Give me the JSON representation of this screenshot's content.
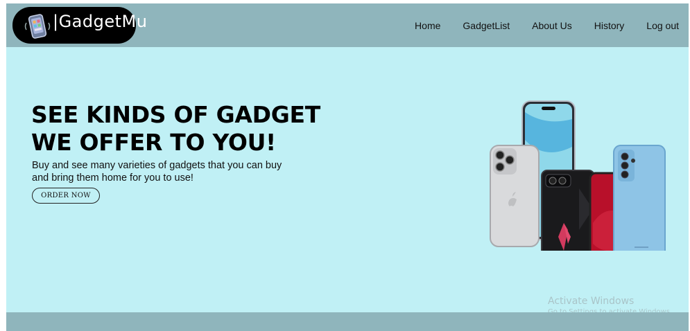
{
  "brand": {
    "name": "|GadgetMu",
    "logo_icon": "phone-icon"
  },
  "nav": {
    "items": [
      {
        "label": "Home"
      },
      {
        "label": "GadgetList"
      },
      {
        "label": "About Us"
      },
      {
        "label": "History"
      },
      {
        "label": "Log out"
      }
    ]
  },
  "hero": {
    "title_line1": "SEE KINDS OF GADGET",
    "title_line2": "WE OFFER TO YOU!",
    "desc_line1": "Buy and see many varieties of gadgets that you can buy",
    "desc_line2": "and bring them home for you to use!",
    "cta_label": "ORDER NOW"
  },
  "watermark": {
    "title": "Activate Windows",
    "subtitle": "Go to Settings to activate Windows."
  },
  "colors": {
    "navbar": "#8fb5bc",
    "hero_bg": "#c0f0f5",
    "footer": "#8fb5bc",
    "logo_bg": "#000000"
  }
}
